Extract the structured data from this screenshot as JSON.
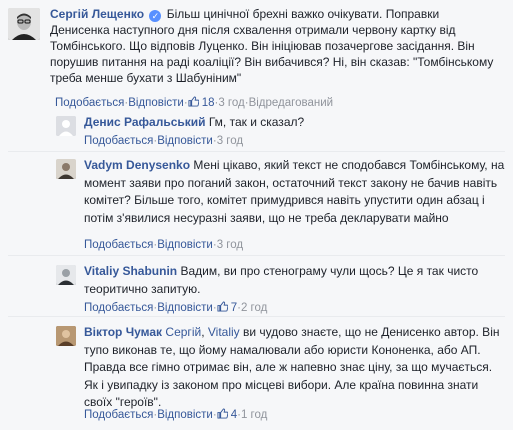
{
  "main_comment": {
    "author": "Сергій Лещенко",
    "text": "Більш цинічної брехні важко очікувати. Поправки Денисенка наступного дня після схвалення отримали червону картку від Томбінського. Що відповів Луценко. Він ініціював позачергове засідання. Він порушив питання на раді коаліції? Він вибачився? Ні, він сказав: \"Томбінському треба менше бухати з Шабуніним\"",
    "like": "Подобається",
    "reply": "Відповісти",
    "likes": "18",
    "time": "3 год",
    "edited": "Відредагований"
  },
  "replies": [
    {
      "author": "Денис Рафальський",
      "text": "Гм, так и сказал?",
      "like": "Подобається",
      "reply": "Відповісти",
      "time": "3 год"
    },
    {
      "author": "Vadym Denysenko",
      "text": "Мені цікаво, який текст не сподобався Томбінському, на момент заяви про поганий закон, остаточний текст закону не бачив навіть комітет? Більше того, комітет примудрився навіть упустити один абзац і потім з'явилися несуразні заяви, що не треба декларувати майно",
      "like": "Подобається",
      "reply": "Відповісти",
      "time": "3 год"
    },
    {
      "author": "Vitaliy Shabunin",
      "text": "Вадим, ви про стенограму чули щось? Це я так чисто теоритично запитую.",
      "like": "Подобається",
      "reply": "Відповісти",
      "likes": "7",
      "time": "2 год"
    },
    {
      "author": "Віктор Чумак",
      "mention1": "Сергій",
      "mention2": "Vitaliy",
      "text": "ви чудово знаєте, що не Денисенко автор. Він тупо виконав те, що йому намалювали або юристи Кононенка, або АП. Правда все гімно отримає він, але ж напевно знає ціну, за що мучається. Як і увипадку із законом про місцеві вибори. Але країна повинна знати своїх \"героїв\".",
      "like": "Подобається",
      "reply": "Відповісти",
      "likes": "4",
      "time": "1 год"
    }
  ],
  "colors": {
    "link": "#365899",
    "meta": "#90949c",
    "background": "#f6f7f9",
    "verified": "#5890ff"
  }
}
